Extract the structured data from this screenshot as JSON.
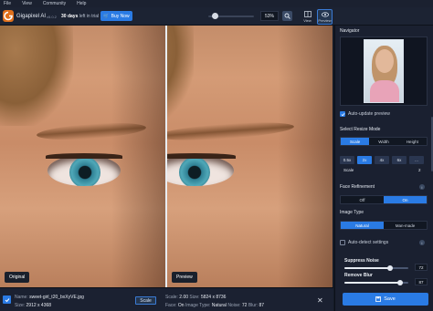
{
  "menu": [
    "File",
    "View",
    "Community",
    "Help"
  ],
  "app": {
    "name": "Gigapixel AI",
    "version": "v5.0.2"
  },
  "trial": {
    "days": "30 days",
    "suffix": "left in trial"
  },
  "buy_now": "Buy Now",
  "zoom": {
    "value": "53%",
    "slider_level": 0.15
  },
  "view_buttons": {
    "view": "View",
    "preview": "Preview"
  },
  "panes": {
    "original_label": "Original",
    "preview_label": "Preview"
  },
  "file": {
    "name_label": "Name:",
    "name": "sweet-girl_t20_bxXyVE.jpg",
    "size_label": "Size:",
    "size": "2912 x 4368",
    "scale_button": "Scale"
  },
  "output": {
    "scale_label": "Scale:",
    "scale": "2.00",
    "size_label": "Size:",
    "size": "5824 x 8736",
    "face_label": "Face:",
    "face": "On",
    "type_label": "Image Type:",
    "type": "Natural",
    "noise_label": "Noise:",
    "noise": "72",
    "blur_label": "Blur:",
    "blur": "87"
  },
  "sidebar": {
    "navigator_title": "Navigator",
    "auto_update": "Auto-update preview",
    "resize_mode_title": "Select Resize Mode",
    "resize_modes": [
      "Scale",
      "Width",
      "Height"
    ],
    "scale_options": [
      "0.5x",
      "2x",
      "4x",
      "6x",
      "..."
    ],
    "scale_label": "Scale",
    "scale_value": "2",
    "face_title": "Face Refinement",
    "face_options": [
      "Off",
      "On"
    ],
    "image_type_title": "Image Type",
    "image_types": [
      "Natural",
      "Man-made"
    ],
    "auto_detect": "Auto-detect settings",
    "suppress_noise_label": "Suppress Noise",
    "suppress_noise_value": "72",
    "remove_blur_label": "Remove Blur",
    "remove_blur_value": "87",
    "save": "Save"
  },
  "colors": {
    "accent": "#2a7be4",
    "brand": "#e0701c",
    "panel": "#1a2030"
  }
}
